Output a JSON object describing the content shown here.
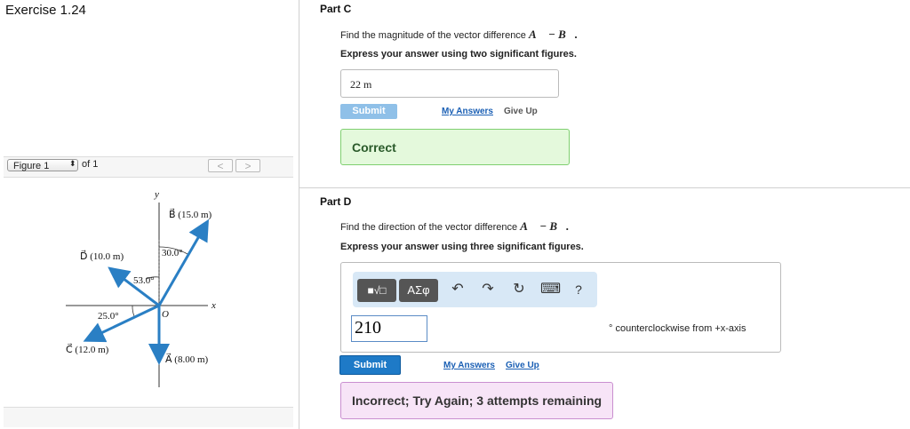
{
  "exercise_title": "Exercise 1.24",
  "figure": {
    "select_label": "Figure 1",
    "of_label": "of 1",
    "prev": "<",
    "next": ">",
    "labels": {
      "y_axis": "y",
      "x_axis": "x",
      "origin": "O",
      "B": "B⃗ (15.0 m)",
      "D": "D⃗ (10.0 m)",
      "C": "C⃗ (12.0 m)",
      "A": "A⃗  (8.00 m)",
      "angle_30": "30.0°",
      "angle_53": "53.0°",
      "angle_25": "25.0°"
    }
  },
  "part_c": {
    "title": "Part C",
    "question_prefix": "Find the magnitude of the vector difference ",
    "question_expr": "A⃗ − B⃗.",
    "instruction": "Express your answer using two significant figures.",
    "answer_value": "22  m",
    "submit": "Submit",
    "my_answers": "My Answers",
    "give_up": "Give Up",
    "result": "Correct"
  },
  "part_d": {
    "title": "Part D",
    "question_prefix": "Find the direction of the vector difference ",
    "question_expr": "A⃗ − B⃗.",
    "instruction": "Express your answer using three significant figures.",
    "toolbar": {
      "template": "■√□",
      "greek": "ΑΣφ",
      "undo": "↶",
      "redo": "↷",
      "reset": "↻",
      "keyboard": "⌨",
      "help": "?"
    },
    "answer_value": "210",
    "unit": "° counterclockwise from +x-axis",
    "submit": "Submit",
    "my_answers": "My Answers",
    "give_up": "Give Up",
    "result": "Incorrect; Try Again; 3 attempts remaining"
  },
  "colors": {
    "arrow": "#2a7fc4",
    "correct_bg": "#e4f9dc",
    "incorrect_bg": "#f7e4f7",
    "submit": "#1e7ac7"
  }
}
